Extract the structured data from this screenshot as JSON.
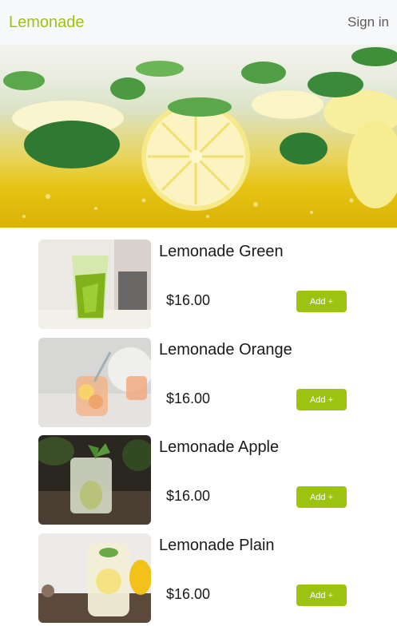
{
  "navbar": {
    "brand": "Lemonade",
    "sign_in": "Sign in"
  },
  "theme": {
    "accent": "#9cc30f",
    "navbar_bg": "#f8f9fa"
  },
  "hero": {
    "image": "lemonade-with-mint-and-lemon-slices"
  },
  "products": [
    {
      "name": "Lemonade Green",
      "price": "$16.00",
      "button": "Add +",
      "image": "green-lemonade-glass"
    },
    {
      "name": "Lemonade Orange",
      "price": "$16.00",
      "button": "Add +",
      "image": "orange-lemonade-glass"
    },
    {
      "name": "Lemonade Apple",
      "price": "$16.00",
      "button": "Add +",
      "image": "apple-pear-lemonade-glass"
    },
    {
      "name": "Lemonade Plain",
      "price": "$16.00",
      "button": "Add +",
      "image": "plain-lemonade-glass"
    }
  ]
}
